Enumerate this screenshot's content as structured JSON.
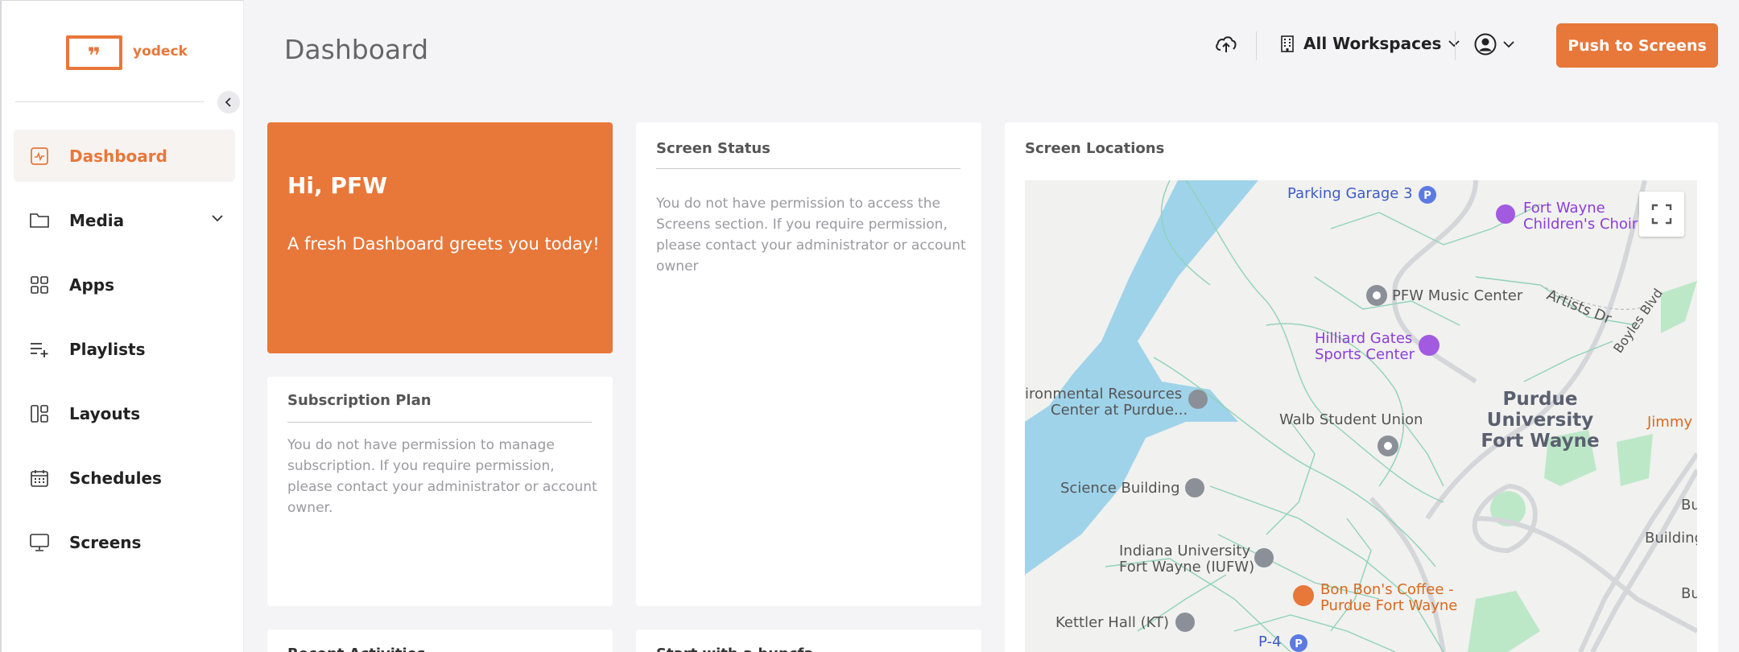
{
  "brand": {
    "name": "yodeck",
    "accent": "#e8773a"
  },
  "sidebar": {
    "items": [
      {
        "label": "Dashboard",
        "icon": "dashboard-icon",
        "active": true
      },
      {
        "label": "Media",
        "icon": "folder-icon",
        "has_submenu": true
      },
      {
        "label": "Apps",
        "icon": "apps-grid-icon"
      },
      {
        "label": "Playlists",
        "icon": "playlist-add-icon"
      },
      {
        "label": "Layouts",
        "icon": "layout-icon"
      },
      {
        "label": "Schedules",
        "icon": "calendar-icon"
      },
      {
        "label": "Screens",
        "icon": "monitor-icon"
      }
    ]
  },
  "header": {
    "title": "Dashboard",
    "workspace_label": "All Workspaces",
    "push_button": "Push to Screens"
  },
  "welcome": {
    "greeting": "Hi, PFW",
    "message": "A fresh Dashboard greets you today!"
  },
  "screen_status": {
    "title": "Screen Status",
    "message": "You do not have permission to access the Screens section. If you require permission, please contact your administrator or account owner"
  },
  "subscription": {
    "title": "Subscription Plan",
    "message": "You do not have permission to manage subscription. If you require permission, please contact your administrator or account owner."
  },
  "bottom_cards": {
    "left_title": "Recent Activities",
    "right_title": "Start with a buncfa"
  },
  "locations": {
    "title": "Screen Locations",
    "map_labels": {
      "parking_garage": "Parking Garage 3",
      "choir_1": "Fort Wayne",
      "choir_2": "Children's Choir",
      "music_center": "PFW Music Center",
      "artists_dr": "Artists Dr",
      "boyles": "Boyles Blvd",
      "hilliard_1": "Hilliard Gates",
      "hilliard_2": "Sports Center",
      "env_1": "ironmental Resources",
      "env_2": "Center at Purdue...",
      "walb": "Walb Student Union",
      "purdue_1": "Purdue",
      "purdue_2": "University",
      "purdue_3": "Fort Wayne",
      "jimmy": "Jimmy",
      "science": "Science Building",
      "bu": "Bu",
      "building": "Building",
      "iu_1": "Indiana University",
      "iu_2": "Fort Wayne (IUFW)",
      "bonbons_1": "Bon Bon's Coffee -",
      "bonbons_2": "Purdue Fort Wayne",
      "kettler": "Kettler Hall (KT)",
      "p4": "P-4",
      "bu2": "Bu"
    }
  }
}
